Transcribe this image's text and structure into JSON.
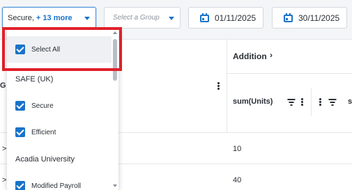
{
  "filters": {
    "company_selected": "Secure,",
    "company_more": "+ 13 more",
    "group_placeholder": "Select a Group",
    "date_from": "01/11/2025",
    "date_to": "30/11/2025"
  },
  "table": {
    "group_header_letter": "G",
    "group_label": "Addition",
    "column_header": "sum(Units)",
    "next_column_letter": "s",
    "rows": [
      {
        "arrow": ">",
        "value": "10"
      },
      {
        "arrow": ">",
        "value": "40"
      }
    ]
  },
  "dropdown": {
    "options": [
      {
        "label": "Select All",
        "checked": true,
        "checkable": true
      },
      {
        "label": "SAFE (UK)",
        "checked": false,
        "checkable": false
      },
      {
        "label": "Secure",
        "checked": true,
        "checkable": true
      },
      {
        "label": "Efficient",
        "checked": true,
        "checkable": true
      },
      {
        "label": "Acadia University",
        "checked": false,
        "checkable": false
      },
      {
        "label": "Modified Payroll",
        "checked": true,
        "checkable": true
      }
    ]
  },
  "colors": {
    "accent": "#1a73c9",
    "highlight": "#e0202a"
  }
}
